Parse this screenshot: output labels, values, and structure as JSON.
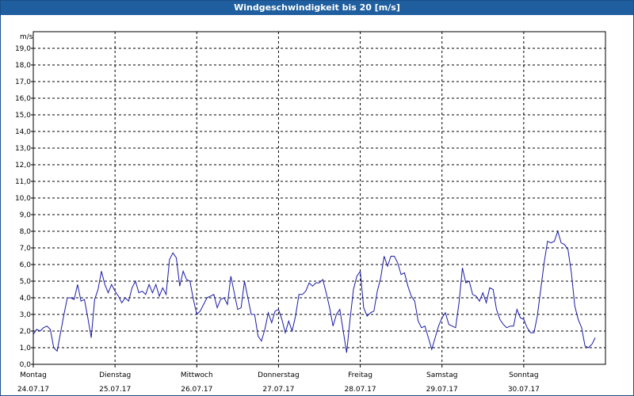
{
  "window": {
    "title": "Windgeschwindigkeit bis 20 [m/s]"
  },
  "chart_data": {
    "type": "line",
    "title": "Windgeschwindigkeit bis 20 [m/s]",
    "ylabel": "m/s",
    "ylim": [
      0,
      20
    ],
    "ytick_step": 1,
    "ytick_labels": [
      "0,0",
      "1,0",
      "2,0",
      "3,0",
      "4,0",
      "5,0",
      "6,0",
      "7,0",
      "8,0",
      "9,0",
      "10,0",
      "11,0",
      "12,0",
      "13,0",
      "14,0",
      "15,0",
      "16,0",
      "17,0",
      "18,0",
      "19,0"
    ],
    "xlim": [
      0,
      168
    ],
    "grid": true,
    "x_ticks": [
      {
        "day": "Montag",
        "date": "24.07.17",
        "x": 0
      },
      {
        "day": "Dienstag",
        "date": "25.07.17",
        "x": 24
      },
      {
        "day": "Mittwoch",
        "date": "26.07.17",
        "x": 48
      },
      {
        "day": "Donnerstag",
        "date": "27.07.17",
        "x": 72
      },
      {
        "day": "Freitag",
        "date": "28.07.17",
        "x": 96
      },
      {
        "day": "Samstag",
        "date": "29.07.17",
        "x": 120
      },
      {
        "day": "Sonntag",
        "date": "30.07.17",
        "x": 144
      }
    ],
    "series": [
      {
        "color": "#1a1aa8",
        "points": [
          [
            0,
            1.8
          ],
          [
            1,
            2.1
          ],
          [
            2,
            2.0
          ],
          [
            3,
            2.2
          ],
          [
            4,
            2.3
          ],
          [
            5,
            2.1
          ],
          [
            6,
            1.0
          ],
          [
            7,
            0.8
          ],
          [
            8,
            1.9
          ],
          [
            9,
            3.0
          ],
          [
            10,
            4.0
          ],
          [
            11,
            4.0
          ],
          [
            12,
            3.9
          ],
          [
            13,
            4.8
          ],
          [
            14,
            3.8
          ],
          [
            15,
            3.9
          ],
          [
            16,
            2.8
          ],
          [
            17,
            1.6
          ],
          [
            18,
            3.9
          ],
          [
            19,
            4.5
          ],
          [
            20,
            5.6
          ],
          [
            21,
            4.8
          ],
          [
            22,
            4.3
          ],
          [
            23,
            4.8
          ],
          [
            24,
            4.4
          ],
          [
            25,
            4.1
          ],
          [
            26,
            3.7
          ],
          [
            27,
            4.0
          ],
          [
            28,
            3.8
          ],
          [
            29,
            4.6
          ],
          [
            30,
            5.0
          ],
          [
            31,
            4.3
          ],
          [
            32,
            4.4
          ],
          [
            33,
            4.2
          ],
          [
            34,
            4.8
          ],
          [
            35,
            4.3
          ],
          [
            36,
            4.8
          ],
          [
            37,
            4.1
          ],
          [
            38,
            4.6
          ],
          [
            39,
            4.2
          ],
          [
            40,
            6.3
          ],
          [
            41,
            6.7
          ],
          [
            42,
            6.4
          ],
          [
            43,
            4.7
          ],
          [
            44,
            5.6
          ],
          [
            45,
            5.1
          ],
          [
            46,
            5.0
          ],
          [
            47,
            3.9
          ],
          [
            48,
            3.0
          ],
          [
            49,
            3.2
          ],
          [
            50,
            3.6
          ],
          [
            51,
            4.0
          ],
          [
            52,
            4.1
          ],
          [
            53,
            4.2
          ],
          [
            54,
            3.4
          ],
          [
            55,
            3.9
          ],
          [
            56,
            4.0
          ],
          [
            57,
            3.6
          ],
          [
            58,
            5.3
          ],
          [
            59,
            4.3
          ],
          [
            60,
            3.3
          ],
          [
            61,
            3.4
          ],
          [
            62,
            5.0
          ],
          [
            63,
            4.0
          ],
          [
            64,
            3.0
          ],
          [
            65,
            3.0
          ],
          [
            66,
            1.7
          ],
          [
            67,
            1.4
          ],
          [
            68,
            2.1
          ],
          [
            69,
            3.1
          ],
          [
            70,
            2.5
          ],
          [
            71,
            3.2
          ],
          [
            72,
            3.3
          ],
          [
            73,
            2.7
          ],
          [
            74,
            1.9
          ],
          [
            75,
            2.6
          ],
          [
            76,
            2.0
          ],
          [
            77,
            2.9
          ],
          [
            78,
            4.2
          ],
          [
            79,
            4.2
          ],
          [
            80,
            4.4
          ],
          [
            81,
            4.9
          ],
          [
            82,
            4.7
          ],
          [
            83,
            4.9
          ],
          [
            84,
            4.9
          ],
          [
            85,
            5.1
          ],
          [
            86,
            4.3
          ],
          [
            87,
            3.4
          ],
          [
            88,
            2.3
          ],
          [
            89,
            3.0
          ],
          [
            90,
            3.3
          ],
          [
            91,
            2.0
          ],
          [
            92,
            0.7
          ],
          [
            93,
            2.7
          ],
          [
            94,
            4.5
          ],
          [
            95,
            5.3
          ],
          [
            96,
            5.6
          ],
          [
            97,
            3.4
          ],
          [
            98,
            2.9
          ],
          [
            99,
            3.1
          ],
          [
            100,
            3.2
          ],
          [
            101,
            4.4
          ],
          [
            102,
            5.2
          ],
          [
            103,
            6.5
          ],
          [
            104,
            5.9
          ],
          [
            105,
            6.5
          ],
          [
            106,
            6.5
          ],
          [
            107,
            6.1
          ],
          [
            108,
            5.4
          ],
          [
            109,
            5.5
          ],
          [
            110,
            4.7
          ],
          [
            111,
            4.1
          ],
          [
            112,
            3.8
          ],
          [
            113,
            2.6
          ],
          [
            114,
            2.2
          ],
          [
            115,
            2.3
          ],
          [
            116,
            1.6
          ],
          [
            117,
            0.9
          ],
          [
            118,
            1.6
          ],
          [
            119,
            2.3
          ],
          [
            120,
            2.8
          ],
          [
            121,
            3.1
          ],
          [
            122,
            2.4
          ],
          [
            123,
            2.3
          ],
          [
            124,
            2.2
          ],
          [
            125,
            3.7
          ],
          [
            126,
            5.8
          ],
          [
            127,
            4.9
          ],
          [
            128,
            5.0
          ],
          [
            129,
            4.2
          ],
          [
            130,
            4.1
          ],
          [
            131,
            3.8
          ],
          [
            132,
            4.3
          ],
          [
            133,
            3.7
          ],
          [
            134,
            4.6
          ],
          [
            135,
            4.5
          ],
          [
            136,
            3.3
          ],
          [
            137,
            2.7
          ],
          [
            138,
            2.4
          ],
          [
            139,
            2.2
          ],
          [
            140,
            2.3
          ],
          [
            141,
            2.3
          ],
          [
            142,
            3.3
          ],
          [
            143,
            2.8
          ],
          [
            144,
            2.7
          ],
          [
            145,
            2.2
          ],
          [
            146,
            1.9
          ],
          [
            147,
            1.9
          ],
          [
            148,
            2.9
          ],
          [
            149,
            4.5
          ],
          [
            150,
            6.1
          ],
          [
            151,
            7.4
          ],
          [
            152,
            7.3
          ],
          [
            153,
            7.4
          ],
          [
            154,
            8.0
          ],
          [
            155,
            7.3
          ],
          [
            156,
            7.2
          ],
          [
            157,
            6.9
          ],
          [
            158,
            5.5
          ],
          [
            159,
            3.5
          ],
          [
            160,
            2.7
          ],
          [
            161,
            2.2
          ],
          [
            162,
            1.1
          ],
          [
            163,
            1.0
          ],
          [
            164,
            1.2
          ],
          [
            165,
            1.6
          ]
        ]
      }
    ]
  }
}
